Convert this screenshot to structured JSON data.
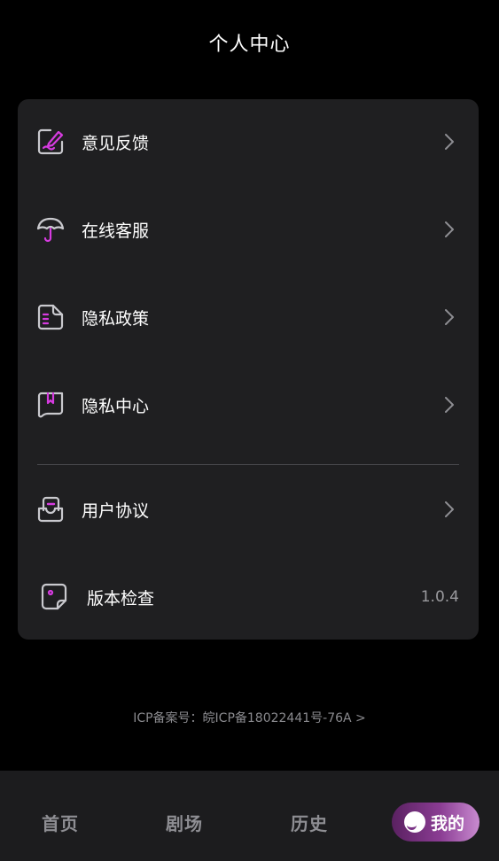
{
  "header": {
    "title": "个人中心"
  },
  "menu": {
    "items": [
      {
        "label": "意见反馈",
        "icon": "feedback-edit-icon"
      },
      {
        "label": "在线客服",
        "icon": "umbrella-service-icon"
      },
      {
        "label": "隐私政策",
        "icon": "policy-document-icon"
      },
      {
        "label": "隐私中心",
        "icon": "bookmark-folder-icon"
      },
      {
        "label": "用户协议",
        "icon": "agreement-tray-icon"
      },
      {
        "label": "版本检查",
        "icon": "version-check-icon",
        "value": "1.0.4"
      }
    ]
  },
  "footer": {
    "icp": "ICP备案号：皖ICP备18022441号-76A >"
  },
  "tab_bar": {
    "tabs": [
      {
        "label": "首页"
      },
      {
        "label": "剧场"
      },
      {
        "label": "历史"
      },
      {
        "label": "我的",
        "active": true
      }
    ]
  },
  "colors": {
    "background": "#000000",
    "card": "#1f1f21",
    "accent": "#d63be0",
    "icon_stroke": "#c9c9ce",
    "tab_inactive": "#8e8e93",
    "active_tab_gradient_start": "#5a2161",
    "active_tab_gradient_end": "#c98bd0"
  }
}
